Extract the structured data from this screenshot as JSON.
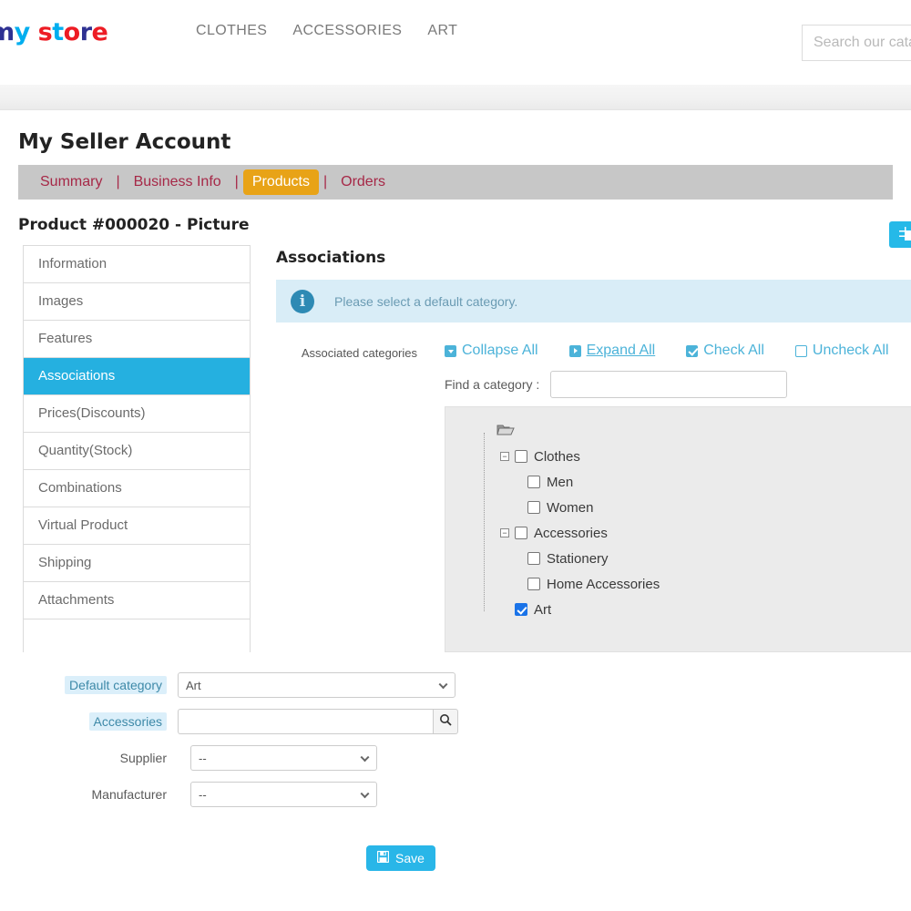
{
  "header": {
    "logo": "my store",
    "nav": [
      {
        "label": "CLOTHES"
      },
      {
        "label": "ACCESSORIES"
      },
      {
        "label": "ART"
      }
    ],
    "search_placeholder": "Search our catalog"
  },
  "seller": {
    "title": "My Seller Account",
    "tabs": [
      {
        "label": "Summary",
        "active": false
      },
      {
        "label": "Business Info",
        "active": false
      },
      {
        "label": "Products",
        "active": true
      },
      {
        "label": "Orders",
        "active": false
      }
    ],
    "separator": "|"
  },
  "product": {
    "title": "Product #000020 - Picture",
    "list_button_icon": "table-list-icon"
  },
  "side_tabs": [
    {
      "label": "Information",
      "active": false
    },
    {
      "label": "Images",
      "active": false
    },
    {
      "label": "Features",
      "active": false
    },
    {
      "label": "Associations",
      "active": true
    },
    {
      "label": "Prices(Discounts)",
      "active": false
    },
    {
      "label": "Quantity(Stock)",
      "active": false
    },
    {
      "label": "Combinations",
      "active": false
    },
    {
      "label": "Virtual Product",
      "active": false
    },
    {
      "label": "Shipping",
      "active": false
    },
    {
      "label": "Attachments",
      "active": false
    }
  ],
  "panel": {
    "title": "Associations",
    "alert": {
      "icon": "info-icon",
      "message": "Please select a default category."
    },
    "categories": {
      "label": "Associated categories",
      "actions": [
        {
          "label": "Collapse All",
          "icon": "collapse-icon"
        },
        {
          "label": "Expand All",
          "icon": "expand-icon"
        },
        {
          "label": "Check All",
          "icon": "check-all-icon"
        },
        {
          "label": "Uncheck All",
          "icon": "uncheck-all-icon"
        }
      ],
      "find_label": "Find a category :",
      "find_value": "",
      "find_placeholder": ""
    },
    "tree": [
      {
        "label": "Clothes",
        "level": 1,
        "checked": false,
        "expandable": true,
        "expander": "−"
      },
      {
        "label": "Men",
        "level": 2,
        "checked": false,
        "expandable": false
      },
      {
        "label": "Women",
        "level": 2,
        "checked": false,
        "expandable": false
      },
      {
        "label": "Accessories",
        "level": 1,
        "checked": false,
        "expandable": true,
        "expander": "−"
      },
      {
        "label": "Stationery",
        "level": 2,
        "checked": false,
        "expandable": false
      },
      {
        "label": "Home Accessories",
        "level": 2,
        "checked": false,
        "expandable": false
      },
      {
        "label": "Art",
        "level": 1,
        "checked": true,
        "expandable": false
      }
    ],
    "form": {
      "default_category": {
        "label": "Default category",
        "value": "Art"
      },
      "accessories": {
        "label": "Accessories",
        "value": "",
        "button_icon": "search-icon"
      },
      "supplier": {
        "label": "Supplier",
        "value": "--"
      },
      "manufacturer": {
        "label": "Manufacturer",
        "value": "--"
      }
    },
    "save": {
      "label": "Save",
      "icon": "floppy-save-icon"
    }
  },
  "colors": {
    "accent_blue": "#25b0e0",
    "tab_active_gold": "#e8a317",
    "tab_link_red": "#a62847",
    "alert_bg": "#d9edf7",
    "tree_bg": "#ebebeb",
    "link_blue": "#4cb3d9",
    "checkbox_checked": "#1a73e8"
  }
}
